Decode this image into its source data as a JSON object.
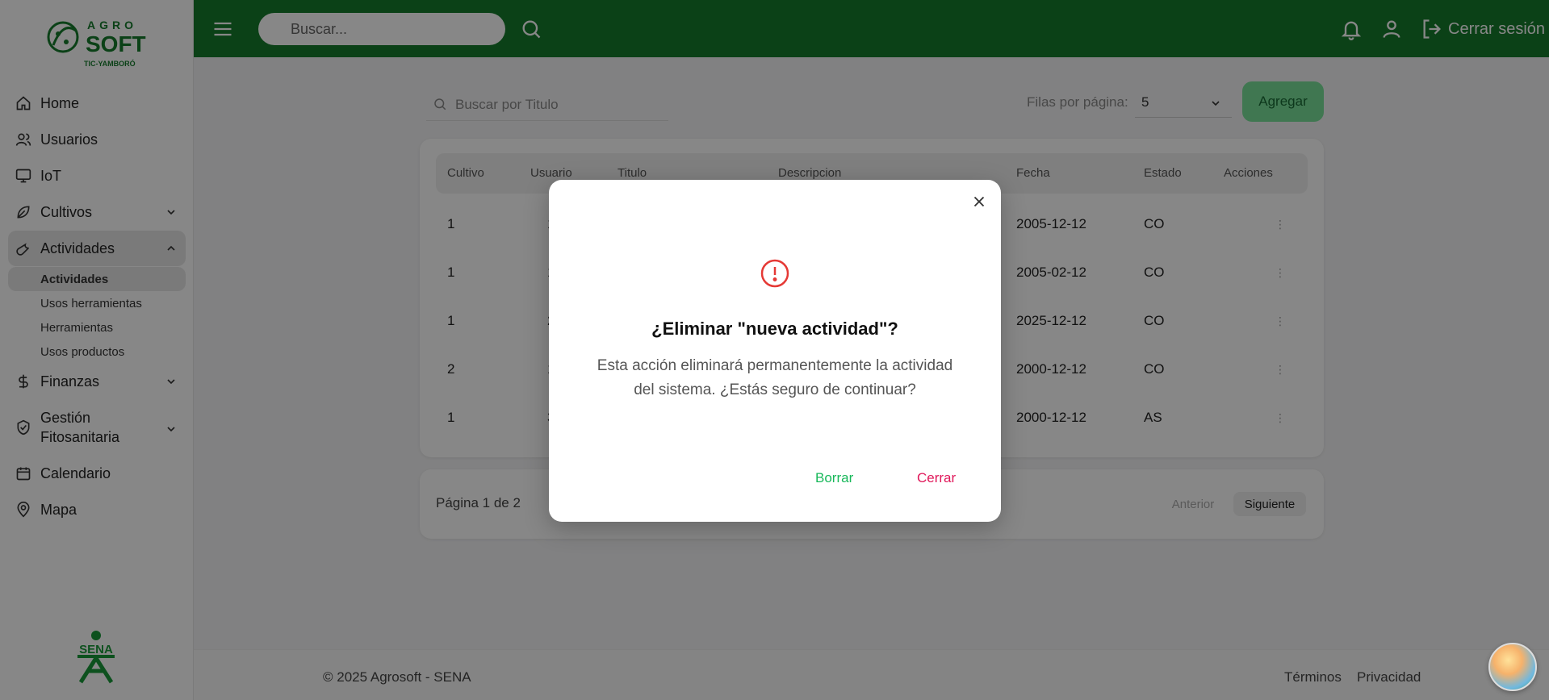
{
  "brand": {
    "agro": "AGRO",
    "soft": "SOFT",
    "tagline": "TIC-YAMBORÓ",
    "sena": "SENA"
  },
  "header": {
    "search_placeholder": "Buscar...",
    "logout_label": "Cerrar sesión"
  },
  "sidebar": {
    "items": [
      {
        "label": "Home"
      },
      {
        "label": "Usuarios"
      },
      {
        "label": "IoT"
      },
      {
        "label": "Cultivos"
      },
      {
        "label": "Actividades"
      },
      {
        "label": "Finanzas"
      },
      {
        "label": "Gestión Fitosanitaria"
      },
      {
        "label": "Calendario"
      },
      {
        "label": "Mapa"
      }
    ],
    "sub_items": [
      {
        "label": "Actividades"
      },
      {
        "label": "Usos herramientas"
      },
      {
        "label": "Herramientas"
      },
      {
        "label": "Usos productos"
      }
    ]
  },
  "toolbar": {
    "search_placeholder": "Buscar por Titulo",
    "rows_label": "Filas por página:",
    "rows_value": "5",
    "add_label": "Agregar"
  },
  "table": {
    "columns": [
      "Cultivo",
      "Usuario",
      "Titulo",
      "Descripcion",
      "Fecha",
      "Estado",
      "Acciones"
    ],
    "rows": [
      {
        "cultivo": "1",
        "usuario": "1",
        "fecha": "2005-12-12",
        "estado": "CO"
      },
      {
        "cultivo": "1",
        "usuario": "1",
        "fecha": "2005-02-12",
        "estado": "CO"
      },
      {
        "cultivo": "1",
        "usuario": "2",
        "fecha": "2025-12-12",
        "estado": "CO"
      },
      {
        "cultivo": "2",
        "usuario": "1",
        "fecha": "2000-12-12",
        "estado": "CO"
      },
      {
        "cultivo": "1",
        "usuario": "3",
        "fecha": "2000-12-12",
        "estado": "AS"
      }
    ]
  },
  "pager": {
    "info": "Página 1 de 2",
    "prev": "Anterior",
    "next": "Siguiente"
  },
  "footer": {
    "copyright": "© 2025 Agrosoft - SENA",
    "terms": "Términos",
    "privacy": "Privacidad"
  },
  "modal": {
    "title": "¿Eliminar \"nueva actividad\"?",
    "message": "Esta acción eliminará permanentemente la actividad del sistema. ¿Estás seguro de continuar?",
    "confirm": "Borrar",
    "cancel": "Cerrar"
  },
  "colors": {
    "header": "#157b2c",
    "accent": "#18b85a",
    "danger": "#e0185a"
  }
}
